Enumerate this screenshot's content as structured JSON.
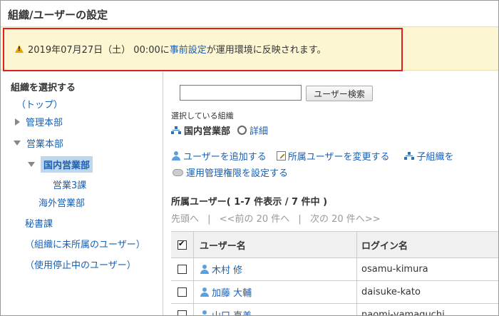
{
  "page_title": "組織/ユーザーの設定",
  "notice": {
    "prefix": "2019年07月27日（土） 00:00に",
    "link": "事前設定",
    "suffix": "が運用環境に反映されます。"
  },
  "sidebar": {
    "heading": "組織を選択する",
    "items": [
      {
        "label": "（トップ）"
      },
      {
        "label": "管理本部"
      },
      {
        "label": "営業本部"
      },
      {
        "label": "国内営業部"
      },
      {
        "label": "営業3課"
      },
      {
        "label": "海外営業部"
      },
      {
        "label": "秘書課"
      },
      {
        "label": "（組織に未所属のユーザー）"
      },
      {
        "label": "（使用停止中のユーザー）"
      }
    ]
  },
  "search": {
    "value": "",
    "button_label": "ユーザー検索"
  },
  "selected_org": {
    "label": "選択している組織",
    "name": "国内営業部",
    "detail_link": "詳細"
  },
  "actions": {
    "add_user": "ユーザーを追加する",
    "change_members": "所属ユーザーを変更する",
    "add_child_org": "子組織を",
    "set_permissions": "運用管理権限を設定する"
  },
  "user_list": {
    "title": "所属ユーザー( 1-7 件表示 / 7 件中 )",
    "pager": {
      "first": "先頭へ",
      "sep1": "|",
      "prev": "<<前の 20 件へ",
      "sep2": "|",
      "next": "次の 20 件へ>>"
    },
    "columns": {
      "name": "ユーザー名",
      "login": "ログイン名"
    },
    "rows": [
      {
        "name": "木村 修",
        "login": "osamu-kimura"
      },
      {
        "name": "加藤 大輔",
        "login": "daisuke-kato"
      },
      {
        "name": "山口 直美",
        "login": "naomi-yamaguchi"
      }
    ]
  }
}
